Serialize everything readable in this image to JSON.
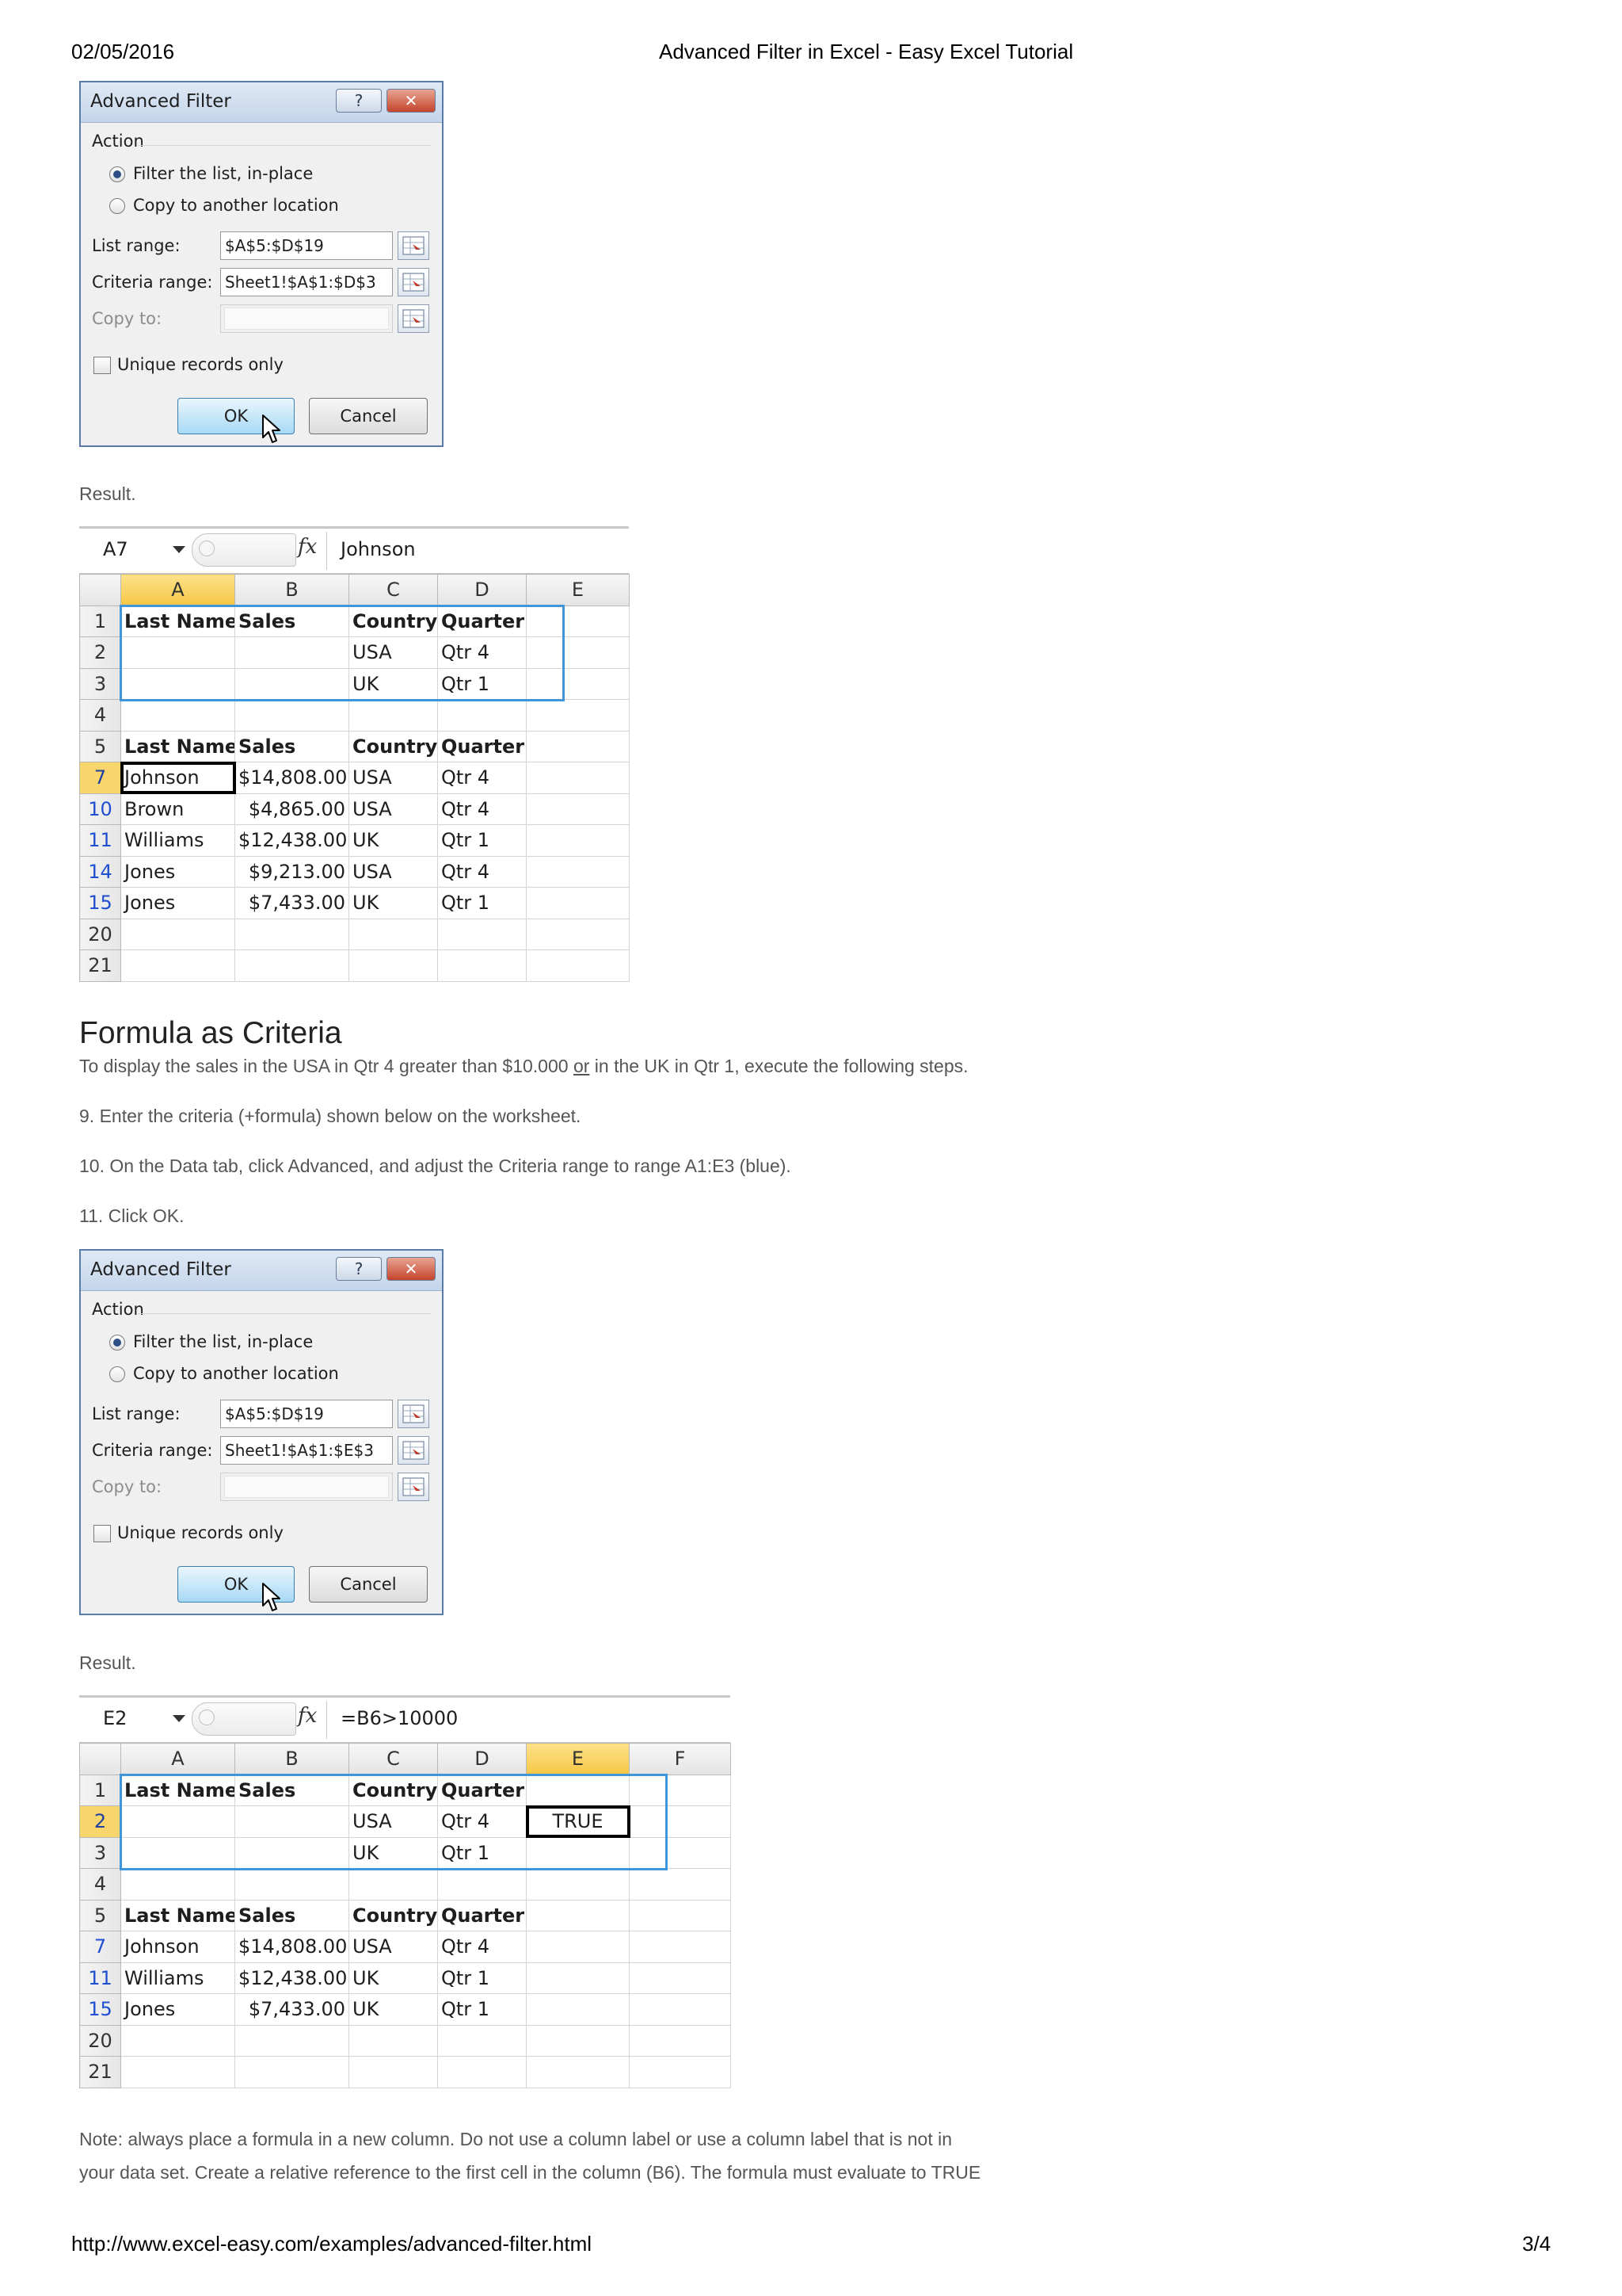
{
  "page_header": {
    "date": "02/05/2016",
    "title": "Advanced Filter in Excel - Easy Excel Tutorial"
  },
  "dialog1": {
    "title": "Advanced Filter",
    "help_label": "?",
    "close_label": "✕",
    "action_label": "Action",
    "radio_filter_label": "Filter the list, in-place",
    "radio_copy_label": "Copy to another location",
    "list_range_label": "List range:",
    "list_range_value": "$A$5:$D$19",
    "criteria_range_label": "Criteria range:",
    "criteria_range_value": "Sheet1!$A$1:$D$3",
    "copy_to_label": "Copy to:",
    "unique_label": "Unique records only",
    "ok_label": "OK",
    "cancel_label": "Cancel"
  },
  "result1_label": "Result.",
  "sheet1": {
    "name_box": "A7",
    "fx_label": "fx",
    "formula_value": "Johnson",
    "columns": [
      "A",
      "B",
      "C",
      "D",
      "E"
    ],
    "rows": [
      {
        "num": "1",
        "cells": [
          "Last Name",
          "Sales",
          "Country",
          "Quarter",
          ""
        ]
      },
      {
        "num": "2",
        "cells": [
          "",
          "",
          "USA",
          "Qtr 4",
          ""
        ]
      },
      {
        "num": "3",
        "cells": [
          "",
          "",
          "UK",
          "Qtr 1",
          ""
        ]
      },
      {
        "num": "4",
        "cells": [
          "",
          "",
          "",
          "",
          ""
        ]
      },
      {
        "num": "5",
        "cells": [
          "Last Name",
          "Sales",
          "Country",
          "Quarter",
          ""
        ]
      },
      {
        "num": "7",
        "cells": [
          "Johnson",
          "$14,808.00",
          "USA",
          "Qtr 4",
          ""
        ]
      },
      {
        "num": "10",
        "cells": [
          "Brown",
          "$4,865.00",
          "USA",
          "Qtr 4",
          ""
        ]
      },
      {
        "num": "11",
        "cells": [
          "Williams",
          "$12,438.00",
          "UK",
          "Qtr 1",
          ""
        ]
      },
      {
        "num": "14",
        "cells": [
          "Jones",
          "$9,213.00",
          "USA",
          "Qtr 4",
          ""
        ]
      },
      {
        "num": "15",
        "cells": [
          "Jones",
          "$7,433.00",
          "UK",
          "Qtr 1",
          ""
        ]
      },
      {
        "num": "20",
        "cells": [
          "",
          "",
          "",
          "",
          ""
        ]
      },
      {
        "num": "21",
        "cells": [
          "",
          "",
          "",
          "",
          ""
        ]
      }
    ]
  },
  "section": {
    "heading": "Formula as Criteria",
    "intro_before": "To display the sales in the USA in Qtr 4 greater than $10.000 ",
    "intro_or": "or",
    "intro_after": " in the UK in Qtr 1, execute the following steps.",
    "step9": "9. Enter the criteria (+formula) shown below on the worksheet.",
    "step10": "10. On the Data tab, click Advanced, and adjust the Criteria range to range A1:E3 (blue).",
    "step11": "11. Click OK."
  },
  "dialog2": {
    "title": "Advanced Filter",
    "help_label": "?",
    "close_label": "✕",
    "action_label": "Action",
    "radio_filter_label": "Filter the list, in-place",
    "radio_copy_label": "Copy to another location",
    "list_range_label": "List range:",
    "list_range_value": "$A$5:$D$19",
    "criteria_range_label": "Criteria range:",
    "criteria_range_value": "Sheet1!$A$1:$E$3",
    "copy_to_label": "Copy to:",
    "unique_label": "Unique records only",
    "ok_label": "OK",
    "cancel_label": "Cancel"
  },
  "result2_label": "Result.",
  "sheet2": {
    "name_box": "E2",
    "fx_label": "fx",
    "formula_value": "=B6>10000",
    "columns": [
      "A",
      "B",
      "C",
      "D",
      "E",
      "F"
    ],
    "rows": [
      {
        "num": "1",
        "cells": [
          "Last Name",
          "Sales",
          "Country",
          "Quarter",
          "",
          ""
        ]
      },
      {
        "num": "2",
        "cells": [
          "",
          "",
          "USA",
          "Qtr 4",
          "TRUE",
          ""
        ]
      },
      {
        "num": "3",
        "cells": [
          "",
          "",
          "UK",
          "Qtr 1",
          "",
          ""
        ]
      },
      {
        "num": "4",
        "cells": [
          "",
          "",
          "",
          "",
          "",
          ""
        ]
      },
      {
        "num": "5",
        "cells": [
          "Last Name",
          "Sales",
          "Country",
          "Quarter",
          "",
          ""
        ]
      },
      {
        "num": "7",
        "cells": [
          "Johnson",
          "$14,808.00",
          "USA",
          "Qtr 4",
          "",
          ""
        ]
      },
      {
        "num": "11",
        "cells": [
          "Williams",
          "$12,438.00",
          "UK",
          "Qtr 1",
          "",
          ""
        ]
      },
      {
        "num": "15",
        "cells": [
          "Jones",
          "$7,433.00",
          "UK",
          "Qtr 1",
          "",
          ""
        ]
      },
      {
        "num": "20",
        "cells": [
          "",
          "",
          "",
          "",
          "",
          ""
        ]
      },
      {
        "num": "21",
        "cells": [
          "",
          "",
          "",
          "",
          "",
          ""
        ]
      }
    ]
  },
  "note": {
    "line1": "Note: always place a formula in a new column. Do not use a column label or use a column label that is not in",
    "line2": "your data set. Create a relative reference to the first cell in the column (B6). The formula must evaluate to TRUE"
  },
  "page_footer": {
    "url": "http://www.excel-easy.com/examples/advanced-filter.html",
    "page": "3/4"
  },
  "colors": {
    "criteria_border": "#4096d8",
    "selected_header": "#f6c644",
    "row_number_blue": "#1f4fd0"
  }
}
